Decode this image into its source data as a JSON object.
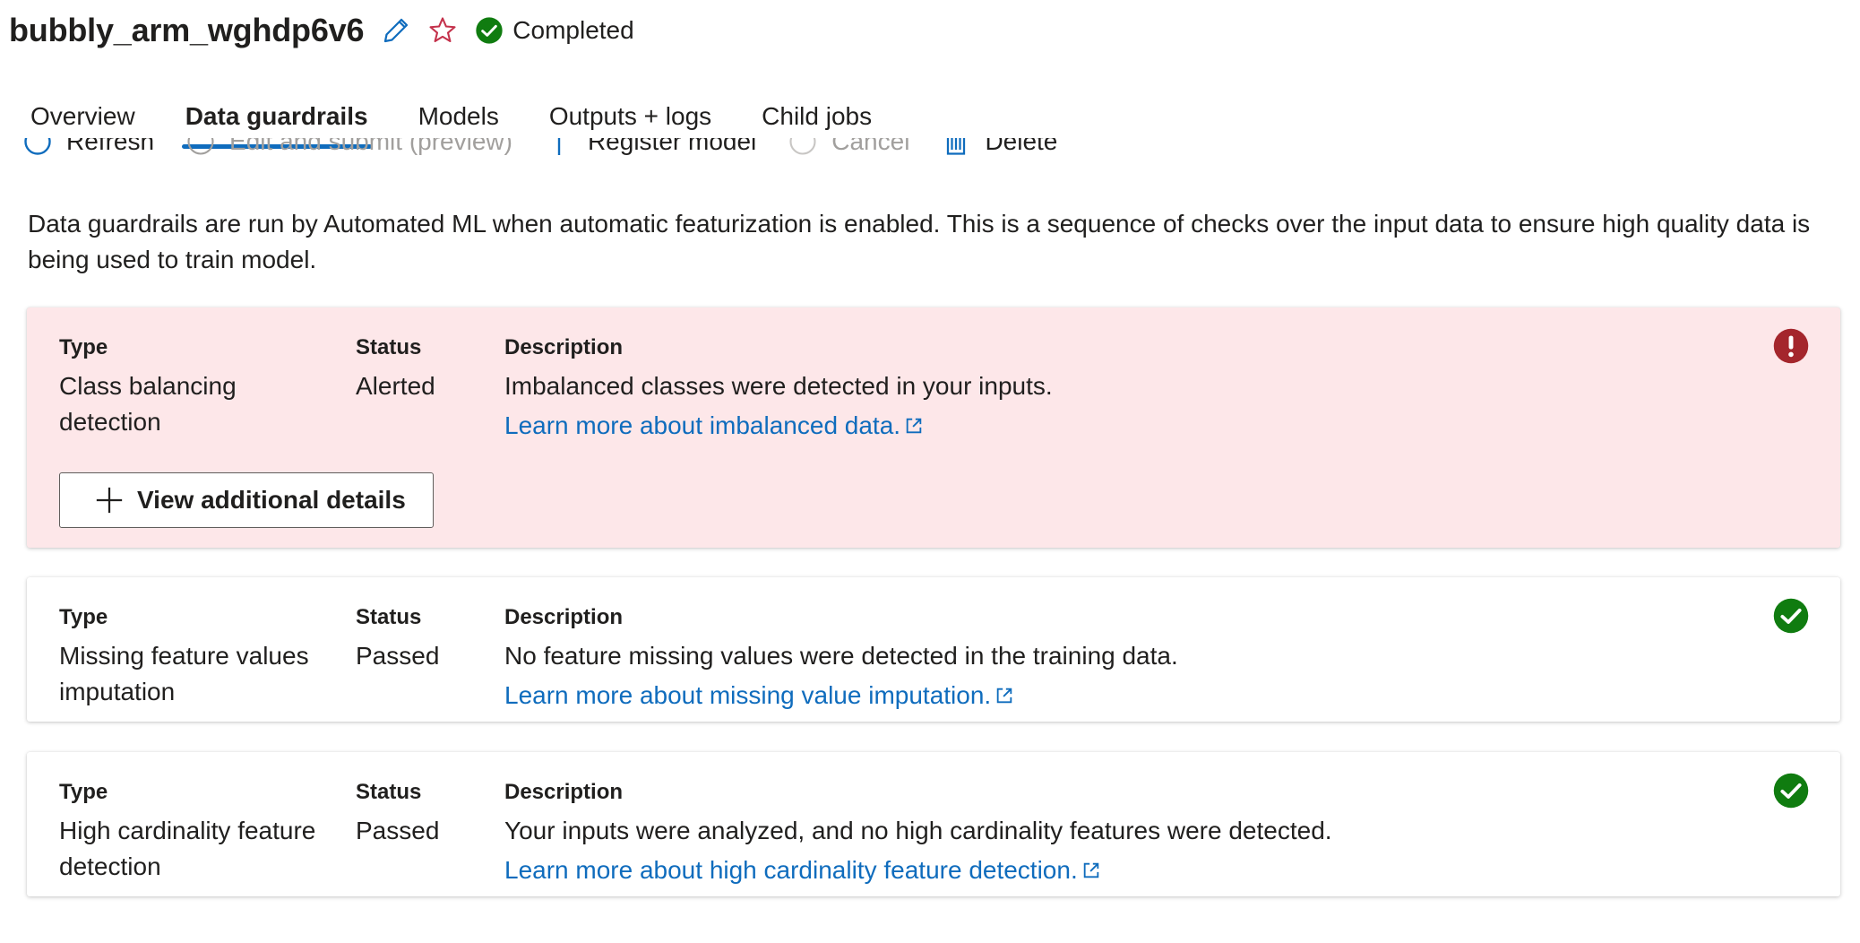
{
  "header": {
    "title": "bubbly_arm_wghdp6v6",
    "status": "Completed",
    "icons": {
      "edit": "pencil-icon",
      "favorite": "star-outline-icon",
      "status": "check-circle-icon"
    },
    "colors": {
      "edit": "#0f6cbd",
      "favorite": "#c4314b",
      "success": "#107c10"
    }
  },
  "tabs": [
    {
      "label": "Overview",
      "active": false
    },
    {
      "label": "Data guardrails",
      "active": true
    },
    {
      "label": "Models",
      "active": false
    },
    {
      "label": "Outputs + logs",
      "active": false
    },
    {
      "label": "Child jobs",
      "active": false
    }
  ],
  "toolbar": {
    "refresh": "Refresh",
    "edit_submit": "Edit and submit (preview)",
    "register": "Register model",
    "cancel": "Cancel",
    "delete": "Delete"
  },
  "intro": "Data guardrails are run by Automated ML when automatic featurization is enabled. This is a sequence of checks over the input data to ensure high quality data is being used to train model.",
  "labels": {
    "type": "Type",
    "status": "Status",
    "description": "Description"
  },
  "guardrails": [
    {
      "type": "Class balancing detection",
      "status": "Alerted",
      "description": "Imbalanced classes were detected in your inputs.",
      "link": "Learn more about imbalanced data.",
      "button": "View additional details",
      "icon": "error-circle-icon",
      "color": "#a4262c",
      "bg": "#fde7e9"
    },
    {
      "type": "Missing feature values imputation",
      "status": "Passed",
      "description": "No feature missing values were detected in the training data.",
      "link": "Learn more about missing value imputation.",
      "icon": "check-circle-icon",
      "color": "#107c10"
    },
    {
      "type": "High cardinality feature detection",
      "status": "Passed",
      "description": "Your inputs were analyzed, and no high cardinality features were detected.",
      "link": "Learn more about high cardinality feature detection.",
      "icon": "check-circle-icon",
      "color": "#107c10"
    }
  ]
}
